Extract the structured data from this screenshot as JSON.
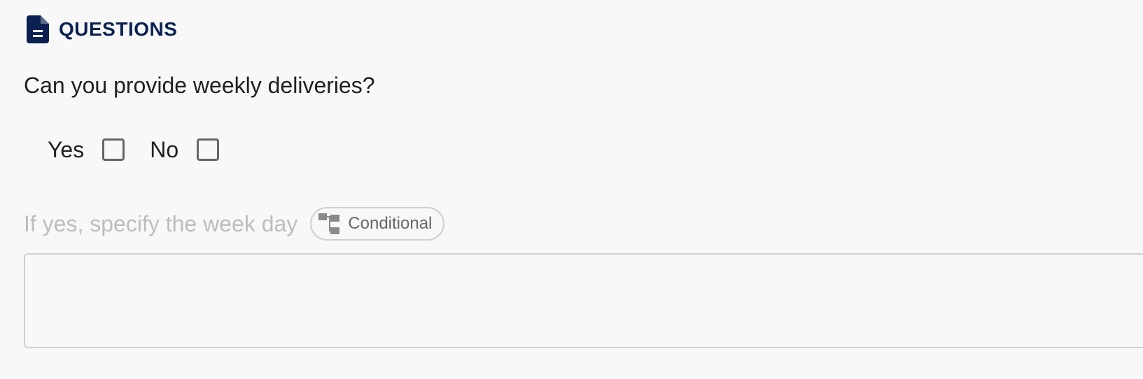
{
  "section": {
    "title": "QUESTIONS",
    "icon": "document-icon",
    "accent_color": "#0b2152"
  },
  "question": {
    "text": "Can you provide weekly deliveries?",
    "options": [
      {
        "label": "Yes",
        "checked": false
      },
      {
        "label": "No",
        "checked": false
      }
    ]
  },
  "conditional_question": {
    "text": "If yes, specify the week day",
    "badge_label": "Conditional",
    "badge_icon": "branch-icon",
    "answer_value": ""
  }
}
